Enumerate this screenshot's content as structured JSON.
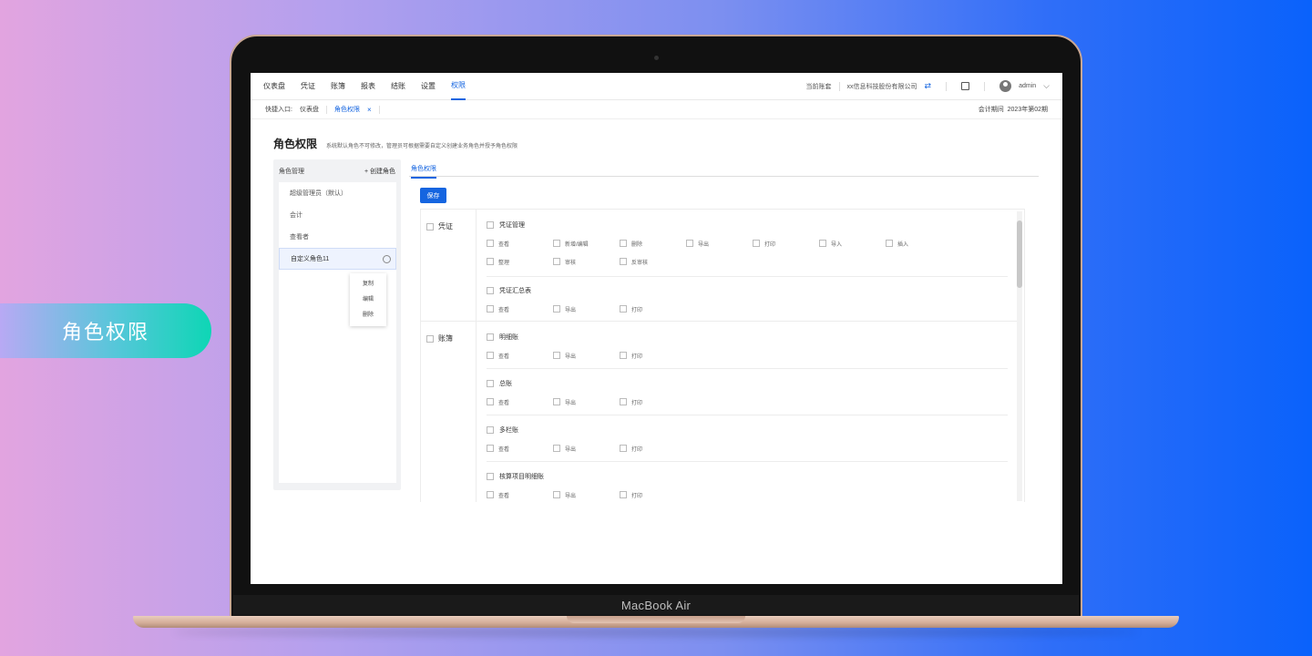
{
  "feature_label": "角色权限",
  "device_label": "MacBook Air",
  "nav": {
    "items": [
      "仪表盘",
      "凭证",
      "账簿",
      "报表",
      "结账",
      "设置",
      "权限"
    ],
    "active_index": 6,
    "company_label": "当前账套",
    "company_name": "xx信息科技股份有限公司",
    "user": "admin"
  },
  "quickbar": {
    "label": "快捷入口:",
    "tabs": [
      "仪表盘",
      "角色权限"
    ],
    "close_icon": "×",
    "period_label": "会计期间",
    "period_value": "2023年第02期"
  },
  "page": {
    "title": "角色权限",
    "description": "系统默认角色不可修改，管理员可根据需要自定义创建业务角色并授予角色权限"
  },
  "roles": {
    "header": "角色管理",
    "add_label": "+ 创建角色",
    "items": [
      "超级管理员（默认）",
      "会计",
      "查看者",
      "自定义角色11"
    ],
    "selected_index": 3,
    "menu": [
      "复制",
      "编辑",
      "删除"
    ]
  },
  "permissions": {
    "tab": "角色权限",
    "save_label": "保存",
    "groups": [
      {
        "name": "凭证",
        "sections": [
          {
            "title": "凭证管理",
            "options": [
              "查看",
              "新增/编辑",
              "删除",
              "导出",
              "打印",
              "导入",
              "插入",
              "整理",
              "审核",
              "反审核"
            ]
          },
          {
            "title": "凭证汇总表",
            "options": [
              "查看",
              "导出",
              "打印"
            ]
          }
        ]
      },
      {
        "name": "账簿",
        "sections": [
          {
            "title": "明细账",
            "options": [
              "查看",
              "导出",
              "打印"
            ]
          },
          {
            "title": "总账",
            "options": [
              "查看",
              "导出",
              "打印"
            ]
          },
          {
            "title": "多栏账",
            "options": [
              "查看",
              "导出",
              "打印"
            ]
          },
          {
            "title": "核算项目明细账",
            "options": [
              "查看",
              "导出",
              "打印"
            ]
          }
        ]
      }
    ]
  },
  "colors": {
    "accent": "#1565e0",
    "pill_start": "#b8a9f4",
    "pill_end": "#0ed6b5"
  }
}
